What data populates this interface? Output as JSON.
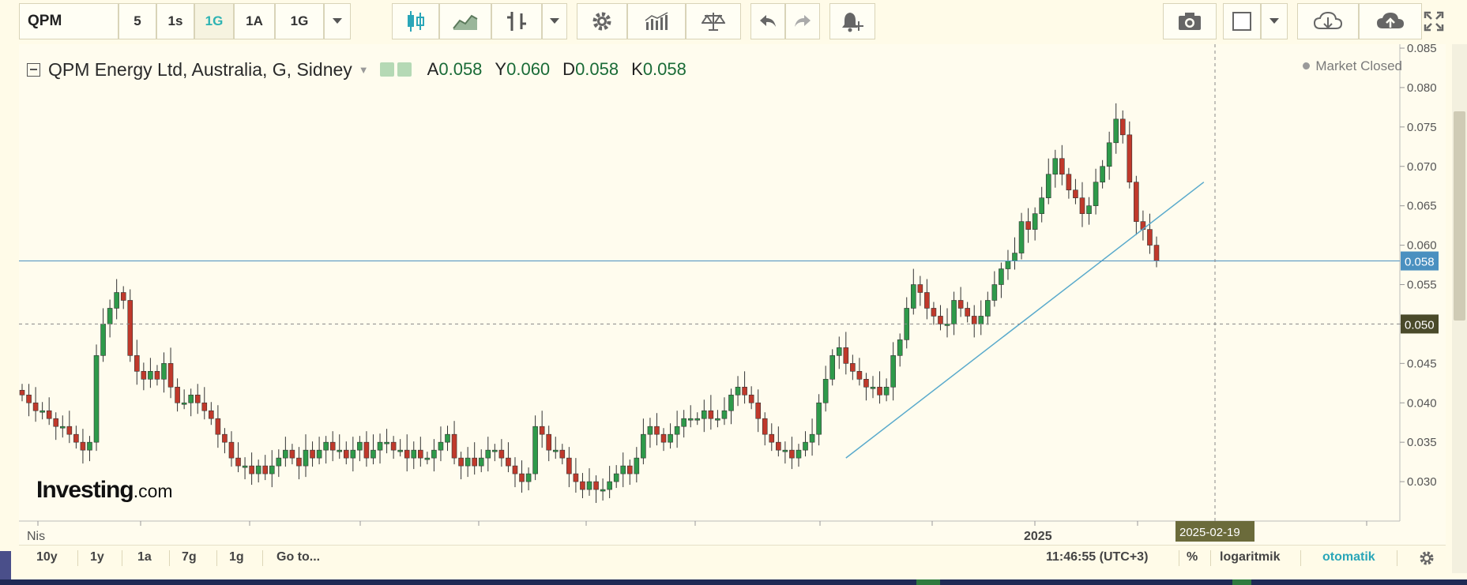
{
  "toolbar": {
    "symbol": "QPM",
    "intervals": [
      "5",
      "1s",
      "1G",
      "1A",
      "1G"
    ],
    "active_interval_index": 2,
    "icons": [
      "candles-icon",
      "area-chart-icon",
      "bars-style-icon",
      "dropdown-caret-icon",
      "settings-gear-icon",
      "indicators-icon",
      "compare-scale-icon",
      "undo-icon",
      "redo-icon",
      "alert-bell-icon",
      "camera-icon",
      "color-box-icon",
      "cloud-download-icon",
      "cloud-upload-icon",
      "fullscreen-icon"
    ],
    "accent": "#2db3b3"
  },
  "legend": {
    "title": "QPM Energy Ltd, Australia, G, Sidney",
    "ohlc": [
      {
        "key": "A",
        "value": "0.058"
      },
      {
        "key": "Y",
        "value": "0.060"
      },
      {
        "key": "D",
        "value": "0.058"
      },
      {
        "key": "K",
        "value": "0.058"
      }
    ]
  },
  "market_status": "Market Closed",
  "watermark": {
    "brand": "Investing",
    "suffix": ".com"
  },
  "bottom": {
    "ranges": [
      "10y",
      "1y",
      "1a",
      "7g",
      "1g"
    ],
    "goto": "Go to...",
    "clock": "11:46:55 (UTC+3)",
    "percent": "%",
    "log": "logaritmik",
    "auto": "otomatik"
  },
  "chart_data": {
    "type": "candlestick",
    "y_axis": {
      "min": 0.025,
      "max": 0.085,
      "ticks": [
        "0.030",
        "0.035",
        "0.040",
        "0.045",
        "0.050",
        "0.055",
        "0.060",
        "0.065",
        "0.070",
        "0.075",
        "0.080",
        "0.085"
      ]
    },
    "x_axis_labels": [
      "Nis",
      "2025"
    ],
    "crosshair_date": "2025-02-19",
    "price_line": {
      "value": 0.058,
      "label": "0.058",
      "color": "#4a90c0"
    },
    "crosshair_price": {
      "value": 0.05,
      "label": "0.050"
    },
    "colors": {
      "up": "#2e9a4a",
      "down": "#c0392b",
      "line": "#5aaacc"
    },
    "close_path": [
      0.041,
      0.04,
      0.039,
      0.039,
      0.038,
      0.037,
      0.037,
      0.036,
      0.035,
      0.034,
      0.035,
      0.046,
      0.05,
      0.052,
      0.054,
      0.053,
      0.046,
      0.044,
      0.043,
      0.044,
      0.043,
      0.045,
      0.042,
      0.04,
      0.04,
      0.041,
      0.04,
      0.039,
      0.038,
      0.036,
      0.035,
      0.033,
      0.032,
      0.032,
      0.031,
      0.032,
      0.031,
      0.032,
      0.033,
      0.034,
      0.033,
      0.032,
      0.034,
      0.033,
      0.034,
      0.035,
      0.034,
      0.034,
      0.033,
      0.034,
      0.035,
      0.033,
      0.034,
      0.035,
      0.035,
      0.034,
      0.034,
      0.033,
      0.034,
      0.033,
      0.033,
      0.034,
      0.035,
      0.036,
      0.033,
      0.032,
      0.033,
      0.032,
      0.033,
      0.034,
      0.034,
      0.033,
      0.032,
      0.031,
      0.03,
      0.031,
      0.037,
      0.036,
      0.034,
      0.034,
      0.033,
      0.031,
      0.03,
      0.029,
      0.03,
      0.029,
      0.029,
      0.03,
      0.031,
      0.032,
      0.031,
      0.033,
      0.036,
      0.037,
      0.036,
      0.035,
      0.036,
      0.037,
      0.038,
      0.038,
      0.038,
      0.039,
      0.038,
      0.038,
      0.039,
      0.041,
      0.042,
      0.041,
      0.04,
      0.038,
      0.036,
      0.035,
      0.034,
      0.034,
      0.033,
      0.034,
      0.035,
      0.036,
      0.04,
      0.043,
      0.046,
      0.047,
      0.045,
      0.044,
      0.043,
      0.042,
      0.042,
      0.041,
      0.042,
      0.046,
      0.048,
      0.052,
      0.055,
      0.054,
      0.052,
      0.051,
      0.05,
      0.05,
      0.053,
      0.052,
      0.051,
      0.05,
      0.051,
      0.053,
      0.055,
      0.057,
      0.058,
      0.059,
      0.063,
      0.062,
      0.064,
      0.066,
      0.069,
      0.071,
      0.069,
      0.067,
      0.066,
      0.064,
      0.065,
      0.068,
      0.07,
      0.073,
      0.076,
      0.074,
      0.068,
      0.063,
      0.062,
      0.06,
      0.058
    ],
    "trendline": {
      "from_index": 122,
      "from_value": 0.033,
      "to_index": 175,
      "to_value": 0.068
    }
  }
}
